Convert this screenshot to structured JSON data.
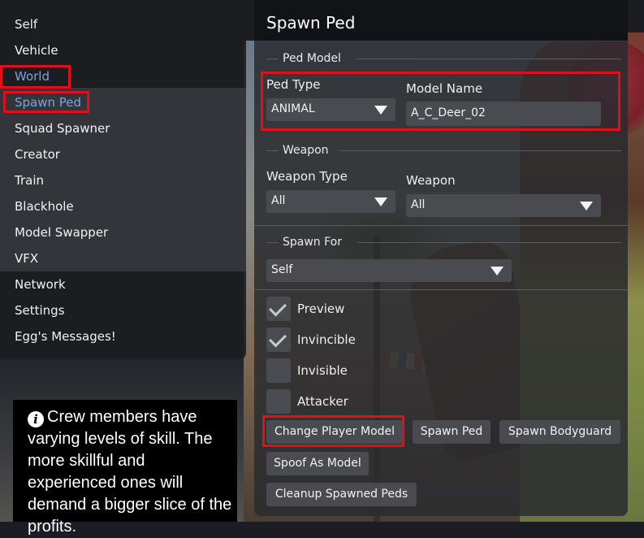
{
  "sidebar": {
    "items": [
      {
        "label": "Self"
      },
      {
        "label": "Vehicle"
      },
      {
        "label": "World"
      },
      {
        "label": "Spawn Ped"
      },
      {
        "label": "Squad Spawner"
      },
      {
        "label": "Creator"
      },
      {
        "label": "Train"
      },
      {
        "label": "Blackhole"
      },
      {
        "label": "Model Swapper"
      },
      {
        "label": "VFX"
      },
      {
        "label": "Network"
      },
      {
        "label": "Settings"
      },
      {
        "label": "Egg's Messages!"
      }
    ],
    "active_parent": "World",
    "active_item": "Spawn Ped"
  },
  "tip": {
    "icon": "info-icon",
    "text": "Crew members have varying levels of skill. The more skillful and experienced ones will demand a bigger slice of the profits."
  },
  "header": {
    "title": "Spawn Ped"
  },
  "ped_model": {
    "title": "Ped Model",
    "ped_type_label": "Ped Type",
    "ped_type_value": "ANIMAL",
    "model_name_label": "Model Name",
    "model_name_value": "A_C_Deer_02"
  },
  "weapon": {
    "title": "Weapon",
    "weapon_type_label": "Weapon Type",
    "weapon_type_value": "All",
    "weapon_label": "Weapon",
    "weapon_value": "All"
  },
  "spawn_for": {
    "title": "Spawn For",
    "value": "Self"
  },
  "options": [
    {
      "label": "Preview",
      "checked": true
    },
    {
      "label": "Invincible",
      "checked": true
    },
    {
      "label": "Invisible",
      "checked": false
    },
    {
      "label": "Attacker",
      "checked": false
    }
  ],
  "buttons": {
    "change_player_model": "Change Player Model",
    "spawn_ped": "Spawn Ped",
    "spawn_bodyguard": "Spawn Bodyguard",
    "spoof_as_model": "Spoof As Model",
    "cleanup": "Cleanup Spawned Peds"
  },
  "colors": {
    "highlight_border": "#e0101a",
    "active_text": "#7aa4e0",
    "control_bg": "#4a4b50"
  }
}
